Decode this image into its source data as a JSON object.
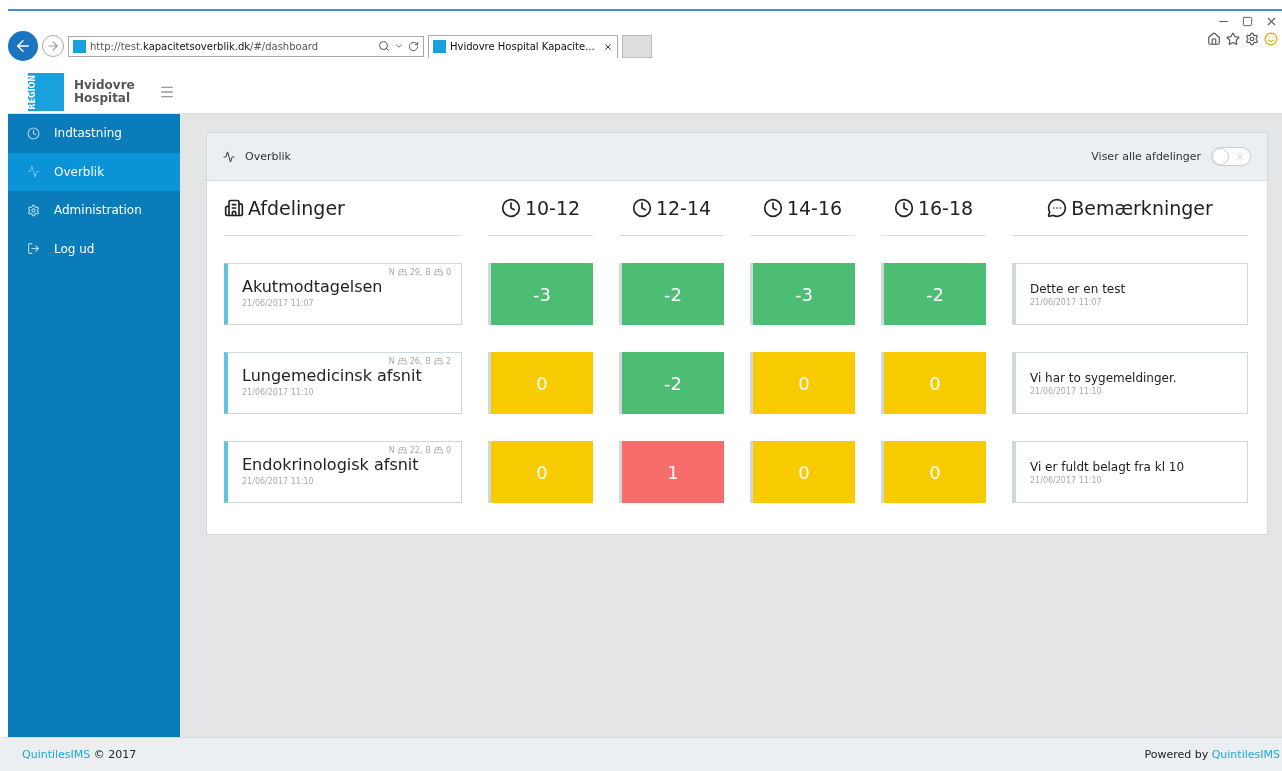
{
  "browser": {
    "url": "http://test.**kapacitetsoverblik.dk**/#/dashboard",
    "tab_title": "Hvidovre Hospital Kapacite..."
  },
  "header": {
    "logo_badge": "REGION",
    "logo_line1": "Hvidovre",
    "logo_line2": "Hospital"
  },
  "sidebar": {
    "items": [
      {
        "label": "Indtastning",
        "kind": "clock",
        "selected": false
      },
      {
        "label": "Overblik",
        "kind": "chart",
        "selected": true
      },
      {
        "label": "Administration",
        "kind": "gear",
        "selected": false
      },
      {
        "label": "Log ud",
        "kind": "logout",
        "selected": false
      }
    ]
  },
  "panel": {
    "title": "Overblik",
    "toggle": {
      "label": "Viser alle afdelinger",
      "on": false
    }
  },
  "table": {
    "columns": [
      {
        "label": "Afdelinger",
        "kind": "building"
      },
      {
        "label": "10-12",
        "kind": "clock"
      },
      {
        "label": "12-14",
        "kind": "clock"
      },
      {
        "label": "14-16",
        "kind": "clock"
      },
      {
        "label": "16-18",
        "kind": "clock"
      },
      {
        "label": "Bemærkninger",
        "kind": "comment"
      }
    ],
    "rows": [
      {
        "name": "Akutmodtagelsen",
        "time": "21/06/2017 11:07",
        "beds": [
          {
            "label": "N",
            "count": "29,"
          },
          {
            "label": "B",
            "count": "0"
          }
        ],
        "slots": [
          {
            "value": "-3",
            "color": "#4dbd74"
          },
          {
            "value": "-2",
            "color": "#4dbd74"
          },
          {
            "value": "-3",
            "color": "#4dbd74"
          },
          {
            "value": "-2",
            "color": "#4dbd74"
          }
        ],
        "remark": {
          "text": "Dette er en test",
          "time": "21/06/2017 11:07"
        }
      },
      {
        "name": "Lungemedicinsk afsnit",
        "time": "21/06/2017 11:10",
        "beds": [
          {
            "label": "N",
            "count": "26,"
          },
          {
            "label": "B",
            "count": "2"
          }
        ],
        "slots": [
          {
            "value": "0",
            "color": "#f8cb00"
          },
          {
            "value": "-2",
            "color": "#4dbd74"
          },
          {
            "value": "0",
            "color": "#f8cb00"
          },
          {
            "value": "0",
            "color": "#f8cb00"
          }
        ],
        "remark": {
          "text": "Vi har to sygemeldinger.",
          "time": "21/06/2017 11:10"
        }
      },
      {
        "name": "Endokrinologisk afsnit",
        "time": "21/06/2017 11:10",
        "beds": [
          {
            "label": "N",
            "count": "22,"
          },
          {
            "label": "B",
            "count": "0"
          }
        ],
        "slots": [
          {
            "value": "0",
            "color": "#f8cb00"
          },
          {
            "value": "1",
            "color": "#f86c6b"
          },
          {
            "value": "0",
            "color": "#f8cb00"
          },
          {
            "value": "0",
            "color": "#f8cb00"
          }
        ],
        "remark": {
          "text": "Vi er fuldt belagt fra kl 10",
          "time": "21/06/2017 11:10"
        }
      }
    ]
  },
  "footer": {
    "brand": "QuintilesIMS",
    "copyright": "© 2017",
    "powered_prefix": "Powered by",
    "powered_brand": "QuintilesIMS"
  }
}
